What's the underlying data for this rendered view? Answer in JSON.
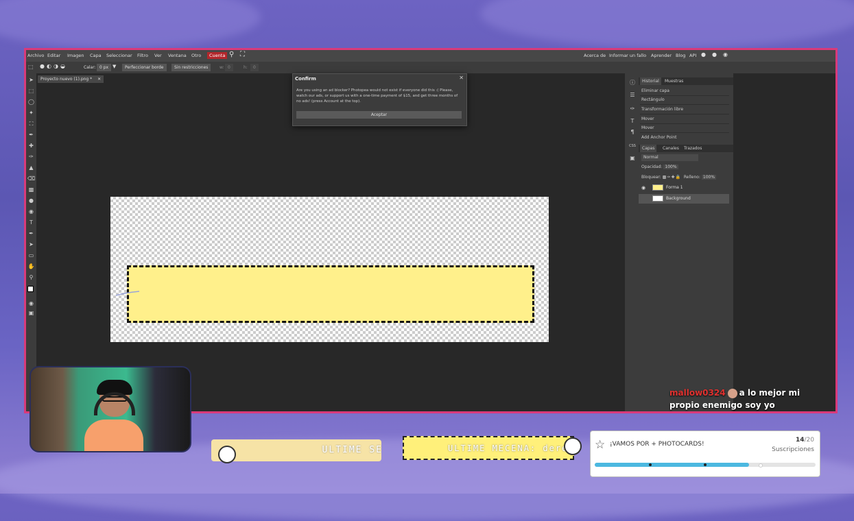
{
  "menu": {
    "items": [
      "Archivo",
      "Editar",
      "Imagen",
      "Capa",
      "Seleccionar",
      "Filtro",
      "Ver",
      "Ventana",
      "Otro"
    ],
    "account": "Cuenta",
    "right_links": [
      "Acerca de",
      "Informar un fallo",
      "Aprender",
      "Blog",
      "API"
    ]
  },
  "options": {
    "feather_label": "Calar:",
    "feather_value": "0 px",
    "refine_edge": "Perfeccionar borde",
    "constraint": "Sin restricciones",
    "w_label": "w:",
    "w_value": "0",
    "h_label": "h:",
    "h_value": "0"
  },
  "document_tab": "Proyecto nuevo (1).png *",
  "dialog": {
    "title": "Confirm",
    "message": "Are you using an ad blocker? Photopea would not exist if everyone did this :( Please, watch our ads, or support us with a one-time payment of $15, and get three months of no ads! (press Account at the top).",
    "button": "Aceptar"
  },
  "history_panel": {
    "tabs": [
      "Historial",
      "Muestras"
    ],
    "items": [
      "Eliminar capa",
      "Rectángulo",
      "Transformación libre",
      "Mover",
      "Mover",
      "Add Anchor Point"
    ]
  },
  "layers_panel": {
    "tabs": [
      "Capas",
      "Canales",
      "Trazados"
    ],
    "blend_mode": "Normal",
    "opacity_label": "Opacidad:",
    "opacity_value": "100%",
    "lock_label": "Bloquear:",
    "fill_label": "Relleno:",
    "fill_value": "100%",
    "layers": [
      "Forma 1",
      "Background"
    ]
  },
  "chat": {
    "user": "mallow0324",
    "message": "a lo mejor mi propio enemigo soy yo"
  },
  "ticker_left": "ULTIME SE",
  "ticker_right": "ULTIME MECENA: dereck",
  "goal": {
    "title": "¡VAMOS POR + PHOTOCARDS!",
    "current": "14",
    "total": "/20",
    "subtitle": "Suscripciones",
    "progress_fraction": 0.7
  },
  "colors": {
    "frame_border": "#d93a7a",
    "shape_fill": "#fff08b",
    "account_button": "#b3262b",
    "goal_fill": "#4cb8e0"
  }
}
